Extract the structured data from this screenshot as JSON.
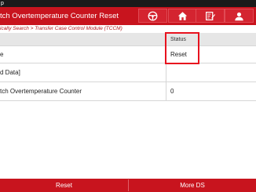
{
  "status_bar": {
    "text": "p"
  },
  "header": {
    "title": "tch Overtemperature Counter Reset",
    "buttons": [
      {
        "icon": "steering-wheel-icon"
      },
      {
        "icon": "home-icon"
      },
      {
        "icon": "report-edit-icon"
      },
      {
        "icon": "user-icon"
      }
    ]
  },
  "breadcrumb": "ically Search > Transfer Case Control Module (TCCM)",
  "table": {
    "header": {
      "col1": "",
      "col2": "Status"
    },
    "rows": [
      {
        "col1": "e",
        "col2": "Reset"
      },
      {
        "col1": "d Data]",
        "col2": ""
      },
      {
        "col1": "tch Overtemperature Counter",
        "col2": "0"
      }
    ]
  },
  "footer": {
    "reset_label": "Reset",
    "more_label": "More DS"
  },
  "colors": {
    "brand": "#c8141e",
    "highlight": "#e8121e"
  }
}
